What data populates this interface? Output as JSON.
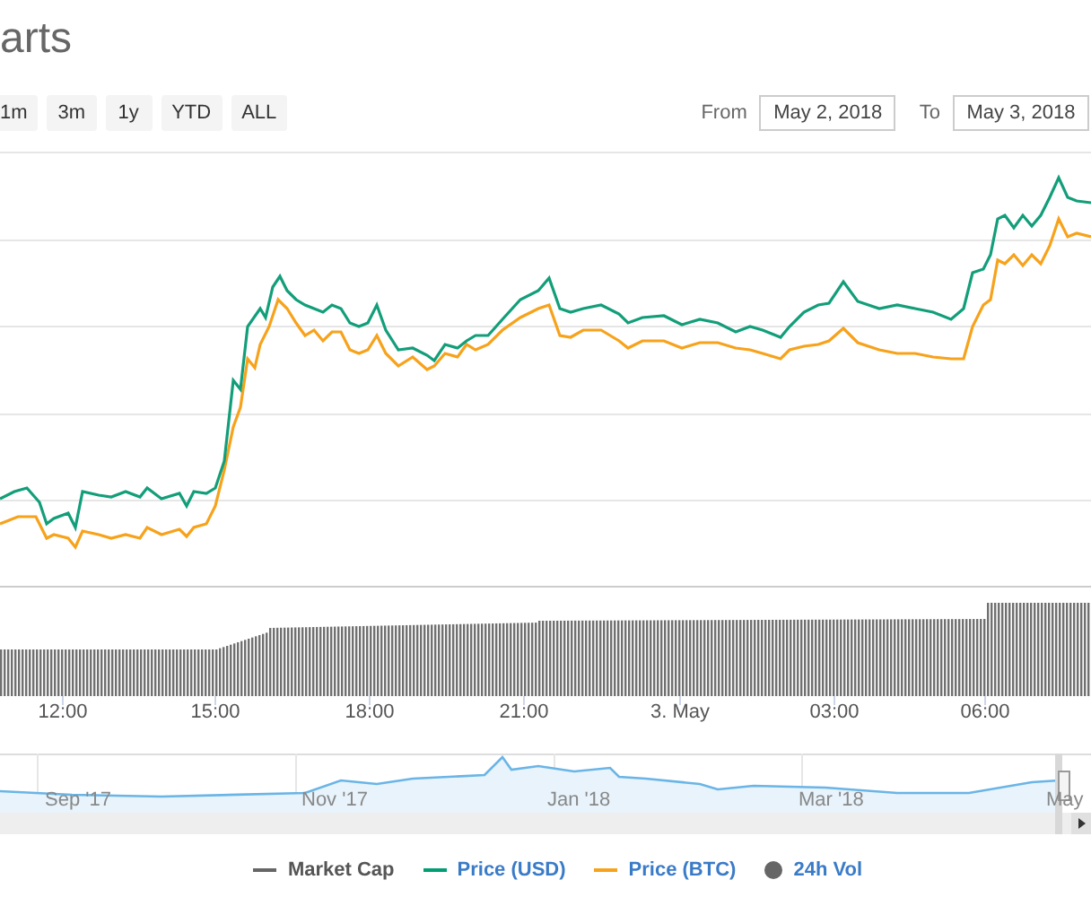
{
  "header": {
    "title": "arts"
  },
  "range_buttons": [
    {
      "label": "1m"
    },
    {
      "label": "3m"
    },
    {
      "label": "1y"
    },
    {
      "label": "YTD"
    },
    {
      "label": "ALL"
    }
  ],
  "date_range": {
    "from_label": "From",
    "from_value": "May 2, 2018",
    "to_label": "To",
    "to_value": "May 3, 2018"
  },
  "chart": {
    "x_labels": [
      "12:00",
      "15:00",
      "18:00",
      "21:00",
      "3. May",
      "03:00",
      "06:00"
    ]
  },
  "navigator": {
    "labels": [
      "Sep '17",
      "Nov '17",
      "Jan '18",
      "Mar '18",
      "May"
    ]
  },
  "legend": [
    {
      "label": "Market Cap",
      "color": "#666666",
      "kind": "line",
      "highlighted": false
    },
    {
      "label": "Price (USD)",
      "color": "#009e73",
      "kind": "line",
      "highlighted": true
    },
    {
      "label": "Price (BTC)",
      "color": "#f7a21b",
      "kind": "line",
      "highlighted": true
    },
    {
      "label": "24h Vol",
      "color": "#666666",
      "kind": "dot",
      "highlighted": true
    }
  ]
}
